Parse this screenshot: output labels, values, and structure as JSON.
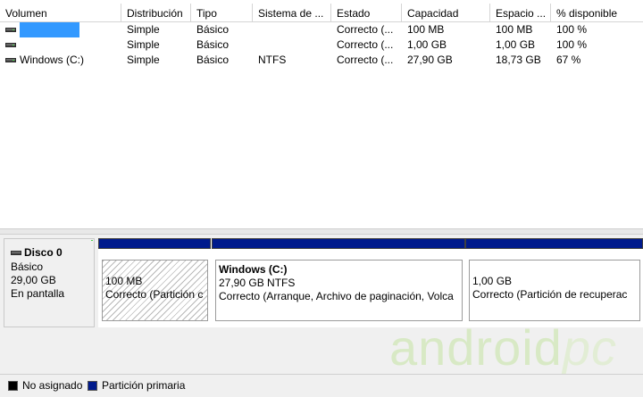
{
  "columns": [
    {
      "label": "Volumen"
    },
    {
      "label": "Distribución"
    },
    {
      "label": "Tipo"
    },
    {
      "label": "Sistema de ..."
    },
    {
      "label": "Estado"
    },
    {
      "label": "Capacidad"
    },
    {
      "label": "Espacio ..."
    },
    {
      "label": "% disponible"
    }
  ],
  "rows": [
    {
      "volume": "",
      "layout": "Simple",
      "type": "Básico",
      "fs": "",
      "status": "Correcto (...",
      "capacity": "100 MB",
      "free": "100 MB",
      "pct": "100 %",
      "selected": true
    },
    {
      "volume": "",
      "layout": "Simple",
      "type": "Básico",
      "fs": "",
      "status": "Correcto (...",
      "capacity": "1,00 GB",
      "free": "1,00 GB",
      "pct": "100 %"
    },
    {
      "volume": "Windows (C:)",
      "layout": "Simple",
      "type": "Básico",
      "fs": "NTFS",
      "status": "Correcto (...",
      "capacity": "27,90 GB",
      "free": "18,73 GB",
      "pct": "67 %"
    }
  ],
  "disk": {
    "title": "Disco 0",
    "type": "Básico",
    "size": "29,00 GB",
    "state": "En pantalla",
    "icon": "drive-icon"
  },
  "partitions": [
    {
      "name": "",
      "line1": "100 MB",
      "line2": "Correcto (Partición c"
    },
    {
      "name": "Windows  (C:)",
      "line1": "27,90 GB NTFS",
      "line2": "Correcto (Arranque, Archivo de paginación, Volca"
    },
    {
      "name": "",
      "line1": "1,00 GB",
      "line2": "Correcto (Partición de recuperac"
    }
  ],
  "legend": [
    {
      "label": "No asignado",
      "color": "#000000"
    },
    {
      "label": "Partición primaria",
      "color": "#001a8c"
    }
  ],
  "watermark": {
    "part1": "android",
    "part2": "pc"
  },
  "colors": {
    "primary_partition": "#001a8c",
    "selection": "#3399ff"
  }
}
